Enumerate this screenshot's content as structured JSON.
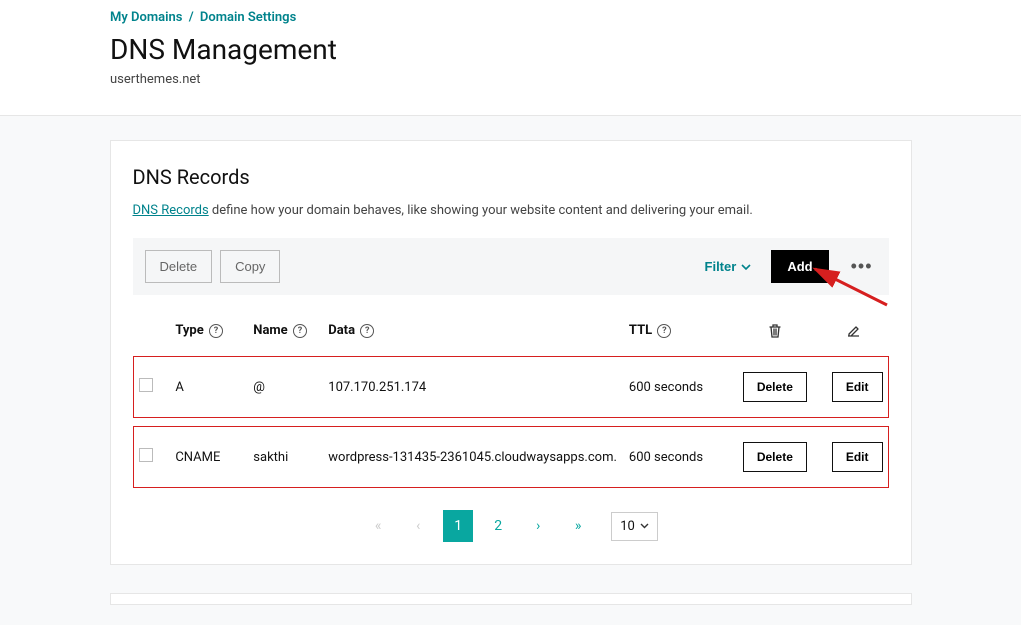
{
  "breadcrumb": {
    "l1": "My Domains",
    "l2": "Domain Settings"
  },
  "page_title": "DNS Management",
  "page_subtitle": "userthemes.net",
  "card": {
    "title": "DNS Records",
    "desc_link": "DNS Records",
    "desc_tail": " define how your domain behaves, like showing your website content and delivering your email."
  },
  "toolbar": {
    "delete": "Delete",
    "copy": "Copy",
    "filter": "Filter",
    "add": "Add"
  },
  "columns": {
    "type": "Type",
    "name": "Name",
    "data": "Data",
    "ttl": "TTL"
  },
  "rows": [
    {
      "type": "A",
      "name": "@",
      "data": "107.170.251.174",
      "ttl": "600 seconds",
      "del": "Delete",
      "edit": "Edit"
    },
    {
      "type": "CNAME",
      "name": "sakthi",
      "data": "wordpress-131435-2361045.cloudwaysapps.com.",
      "ttl": "600 seconds",
      "del": "Delete",
      "edit": "Edit"
    }
  ],
  "pager": {
    "p1": "1",
    "p2": "2",
    "size": "10"
  }
}
